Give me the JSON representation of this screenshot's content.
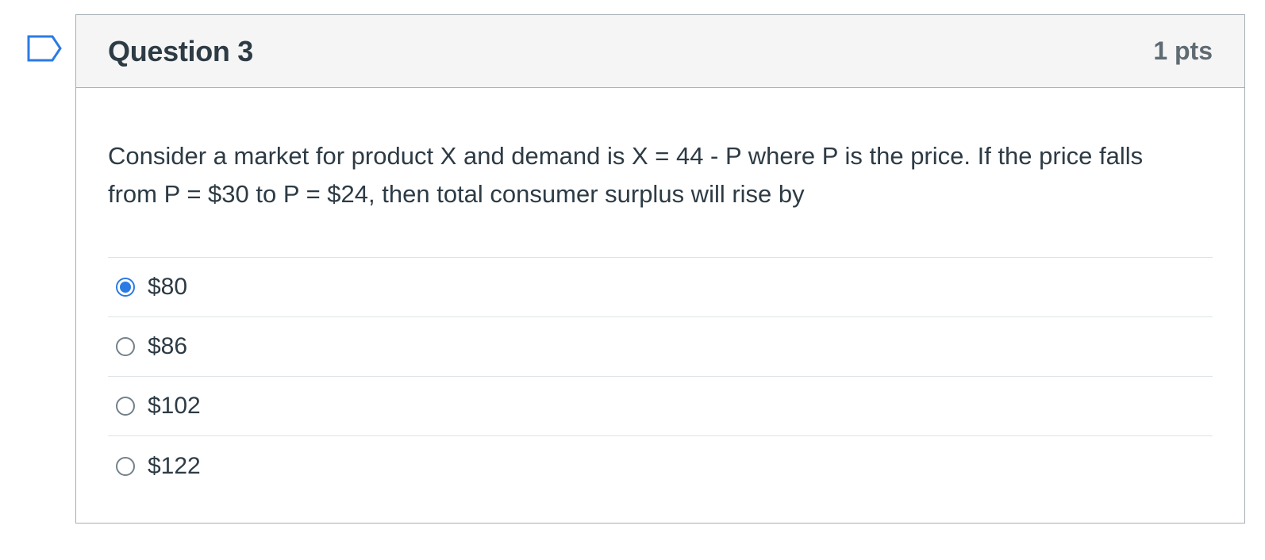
{
  "question": {
    "title": "Question 3",
    "points": "1 pts",
    "text": "Consider a market for product X and demand is X = 44 - P where P is the price.  If the price falls from P = $30 to P = $24, then total consumer surplus will rise by",
    "answers": [
      {
        "label": "$80",
        "selected": true
      },
      {
        "label": "$86",
        "selected": false
      },
      {
        "label": "$102",
        "selected": false
      },
      {
        "label": "$122",
        "selected": false
      }
    ]
  },
  "flag_icon": "bookmark-flag-icon",
  "colors": {
    "accent": "#2a7be4",
    "text": "#2d3b45",
    "header_bg": "#f5f5f5",
    "border": "#a5afb5"
  }
}
